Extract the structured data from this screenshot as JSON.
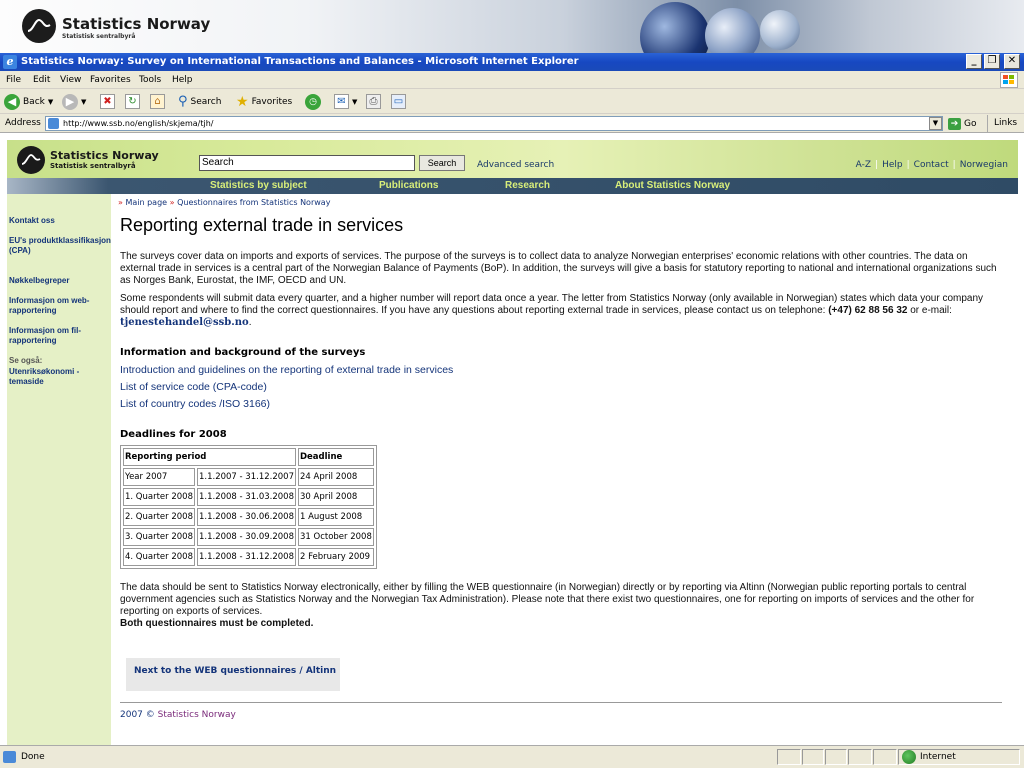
{
  "banner": {
    "brand": "Statistics Norway",
    "brand_sub": "Statistisk sentralbyrå"
  },
  "window": {
    "title": "Statistics Norway: Survey on International Transactions and Balances - Microsoft Internet Explorer",
    "minimize": "_",
    "restore": "❐",
    "close": "✕"
  },
  "menu": {
    "items": [
      "File",
      "Edit",
      "View",
      "Favorites",
      "Tools",
      "Help"
    ]
  },
  "toolbar": {
    "back": "Back",
    "search": "Search",
    "favorites": "Favorites"
  },
  "address": {
    "label": "Address",
    "url": "http://www.ssb.no/english/skjema/tjh/",
    "go": "Go",
    "links": "Links"
  },
  "site": {
    "brand": "Statistics Norway",
    "brand_sub": "Statistisk sentralbyrå",
    "search_value": "Search",
    "search_button": "Search",
    "advanced_search": "Advanced search",
    "top_links": [
      "A-Z",
      "Help",
      "Contact",
      "Norwegian"
    ],
    "nav": [
      "Statistics by subject",
      "Publications",
      "Research",
      "About Statistics Norway"
    ]
  },
  "sidebar": {
    "items": [
      {
        "label": "Kontakt oss"
      },
      {
        "label": "EU's produktklassifikasjon (CPA)"
      },
      {
        "label": "Nøkkelbegreper"
      },
      {
        "label": "Informasjon om web-rapportering"
      },
      {
        "label": "Informasjon om fil-rapportering"
      }
    ],
    "see_also": "Se også:",
    "see_also_link": "Utenriksøkonomi - temaside"
  },
  "breadcrumb": {
    "items": [
      "Main page",
      "Questionnaires from Statistics Norway"
    ]
  },
  "main": {
    "title": "Reporting external trade in services",
    "intro": "The surveys cover data on imports and exports of services. The purpose of the surveys is to collect data to analyze Norwegian enterprises' economic relations with other countries. The data on external trade in services is a central part of the Norwegian Balance of Payments (BoP). In addition, the surveys will give a basis for statutory reporting to national and international organizations such as Norges Bank, Eurostat, the IMF, OECD and UN.",
    "respondents": "Some respondents will submit data every quarter, and a higher number will report data once a year. The letter from Statistics Norway (only available in Norwegian) states which data your company should report and where to find the correct questionnaires. If you have any questions about reporting external trade in services, please contact us on telephone: ",
    "phone": "(+47) 62 88 56 32",
    "or_email": " or e-mail: ",
    "email": "tjenestehandel@ssb.no",
    "info_heading": "Information and background of the surveys",
    "links": [
      "Introduction and guidelines on the reporting of external trade in services",
      "List of service code (CPA-code)",
      "List of country codes /ISO 3166)"
    ],
    "deadlines_heading": "Deadlines for 2008",
    "table": {
      "headers": [
        "Reporting period",
        "Deadline"
      ],
      "rows": [
        [
          "Year 2007",
          "1.1.2007 - 31.12.2007",
          "24 April 2008"
        ],
        [
          "1. Quarter 2008",
          "1.1.2008 - 31.03.2008",
          "30 April 2008"
        ],
        [
          "2. Quarter 2008",
          "1.1.2008 - 30.06.2008",
          "1 August 2008"
        ],
        [
          "3. Quarter 2008",
          "1.1.2008 - 30.09.2008",
          "31 October 2008"
        ],
        [
          "4. Quarter 2008",
          "1.1.2008 - 31.12.2008",
          "2 February 2009"
        ]
      ]
    },
    "send_text": "The data should be sent to Statistics Norway electronically, either by filling the WEB questionnaire (in Norwegian) directly or by reporting via Altinn (Norwegian public reporting portals to central government agencies such as Statistics Norway and the Norwegian Tax Administration). Please note that there exist two questionnaires, one for reporting on imports of services and the other for reporting on exports of services.",
    "both_text": "Both questionnaires must be completed.",
    "altinn_button": "Next to the WEB questionnaires / Altinn",
    "footer_year": "2007 ©",
    "footer_org": "Statistics Norway"
  },
  "status": {
    "text": "Done",
    "zone": "Internet"
  }
}
